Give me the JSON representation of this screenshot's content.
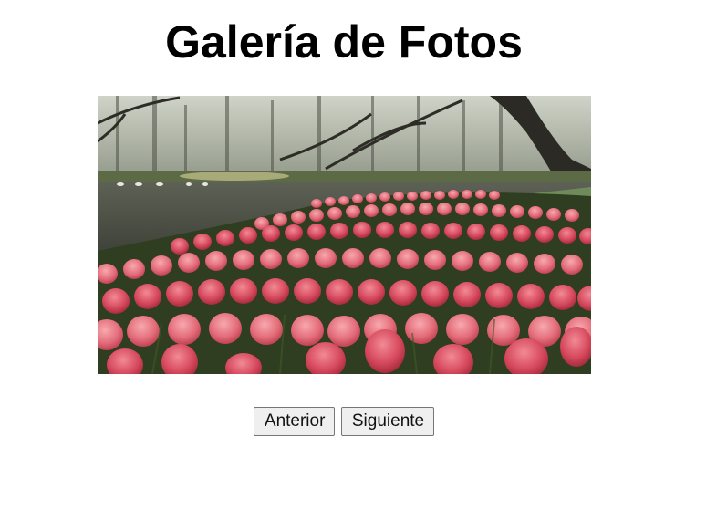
{
  "gallery": {
    "title": "Galería de Fotos",
    "photo": {
      "alt": "Campo de tulipanes rosados junto a un lago"
    },
    "buttons": {
      "previous_label": "Anterior",
      "next_label": "Siguiente"
    }
  }
}
